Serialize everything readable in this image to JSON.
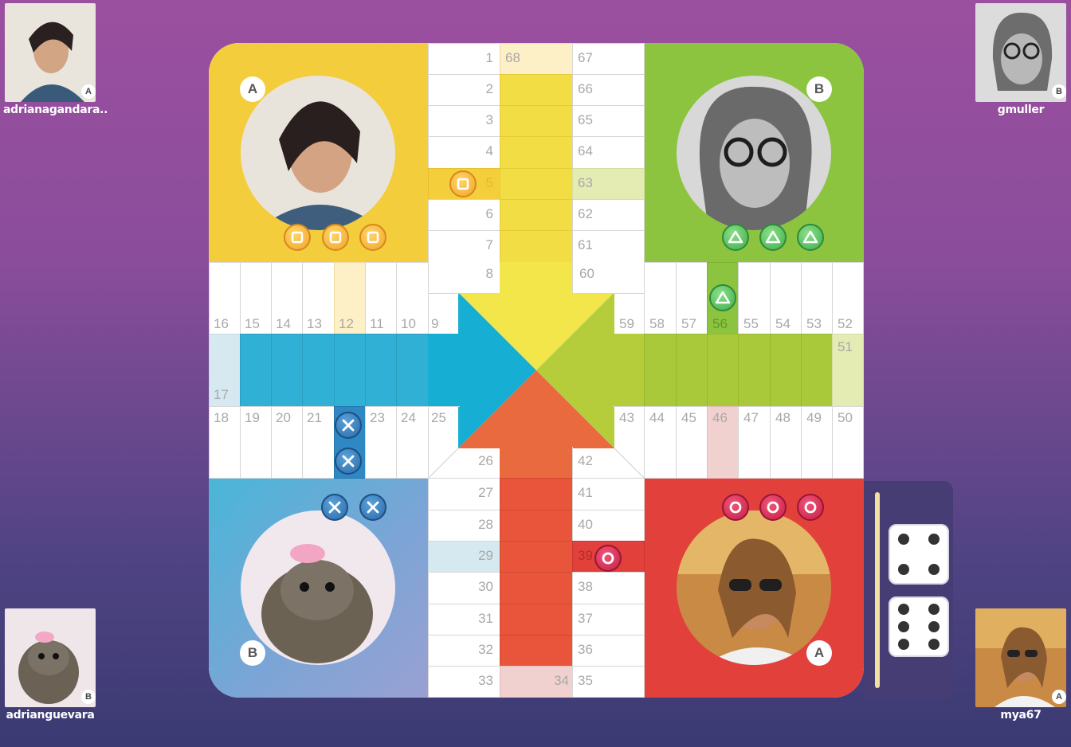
{
  "players": {
    "top_left": {
      "name": "adrianagandara..",
      "team": "A"
    },
    "top_right": {
      "name": "gmuller",
      "team": "B"
    },
    "bottom_left": {
      "name": "adrianguevara",
      "team": "B"
    },
    "bottom_right": {
      "name": "mya67",
      "team": "A"
    }
  },
  "board": {
    "yellow_letter": "A",
    "green_letter": "B",
    "blue_letter": "B",
    "red_letter": "A",
    "colors": {
      "yellow": "#f4cd3c",
      "green": "#8cc43f",
      "blue": "#3db2d6",
      "red": "#e2413b"
    }
  },
  "numbers": {
    "n1": "1",
    "n2": "2",
    "n3": "3",
    "n4": "4",
    "n5": "5",
    "n6": "6",
    "n7": "7",
    "n8": "8",
    "n9": "9",
    "n10": "10",
    "n11": "11",
    "n12": "12",
    "n13": "13",
    "n14": "14",
    "n15": "15",
    "n16": "16",
    "n17": "17",
    "n18": "18",
    "n19": "19",
    "n20": "20",
    "n21": "21",
    "n23": "23",
    "n24": "24",
    "n25": "25",
    "n26": "26",
    "n27": "27",
    "n28": "28",
    "n29": "29",
    "n30": "30",
    "n31": "31",
    "n32": "32",
    "n33": "33",
    "n34": "34",
    "n35": "35",
    "n36": "36",
    "n37": "37",
    "n38": "38",
    "n39": "39",
    "n40": "40",
    "n41": "41",
    "n42": "42",
    "n43": "43",
    "n44": "44",
    "n45": "45",
    "n46": "46",
    "n47": "47",
    "n48": "48",
    "n49": "49",
    "n50": "50",
    "n51": "51",
    "n52": "52",
    "n53": "53",
    "n54": "54",
    "n55": "55",
    "n56": "56",
    "n57": "57",
    "n58": "58",
    "n59": "59",
    "n60": "60",
    "n61": "61",
    "n62": "62",
    "n63": "63",
    "n64": "64",
    "n65": "65",
    "n66": "66",
    "n67": "67",
    "n68": "68"
  },
  "dice": {
    "die1": 4,
    "die2": 6
  }
}
